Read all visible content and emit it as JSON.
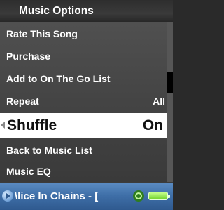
{
  "title": "Music Options",
  "menu": {
    "items": [
      {
        "label": "Rate This Song",
        "value": ""
      },
      {
        "label": "Purchase",
        "value": ""
      },
      {
        "label": "Add to On The Go List",
        "value": ""
      },
      {
        "label": "Repeat",
        "value": "All"
      },
      {
        "label": "Shuffle",
        "value": "On"
      },
      {
        "label": "Back to Music List",
        "value": ""
      },
      {
        "label": "Music EQ",
        "value": ""
      }
    ],
    "selected_index": 4
  },
  "now_playing": {
    "text": "\\lice In Chains - [",
    "icons": [
      "play-icon",
      "shuffle-icon",
      "battery-icon"
    ]
  },
  "colors": {
    "selected_bg": "#ffffff",
    "status_bar": "#3f6fa8",
    "battery": "#6fd12a"
  }
}
